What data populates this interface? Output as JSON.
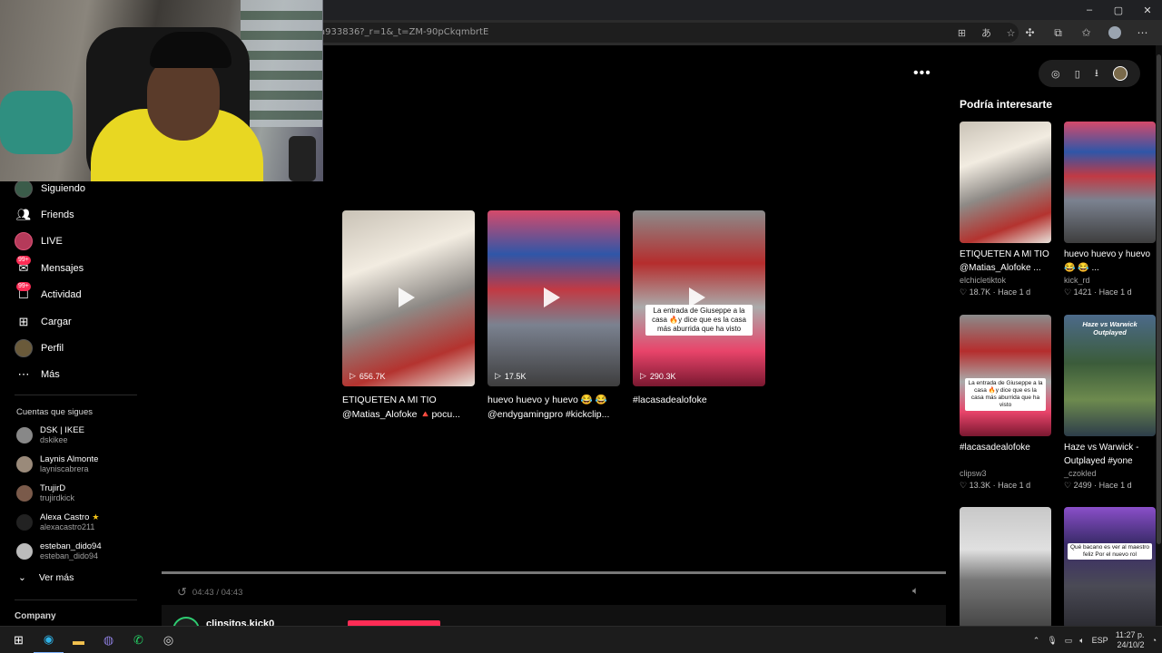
{
  "browser": {
    "url": "a933836?_r=1&_t=ZM-90pCkqmbrtE",
    "window_controls": [
      "–",
      "▢",
      "✕"
    ],
    "toolbar_icons": [
      "⊞",
      "あ",
      "☆",
      "⟳",
      "♡",
      "☆",
      "☺",
      "⋯"
    ],
    "extension_icons": [
      "◎",
      "▯",
      "⭳"
    ]
  },
  "sidebar": {
    "items": [
      {
        "label": "Siguiendo",
        "icon": "avatar-icon"
      },
      {
        "label": "Friends",
        "icon": "friends-icon"
      },
      {
        "label": "LIVE",
        "icon": "live-icon"
      },
      {
        "label": "Mensajes",
        "icon": "messages-icon",
        "badge": "99+"
      },
      {
        "label": "Actividad",
        "icon": "activity-icon",
        "badge": "99+"
      },
      {
        "label": "Cargar",
        "icon": "upload-icon"
      },
      {
        "label": "Perfil",
        "icon": "profile-icon"
      },
      {
        "label": "Más",
        "icon": "more-icon"
      }
    ],
    "following_title": "Cuentas que sigues",
    "accounts": [
      {
        "name": "DSK | IKEE",
        "user": "dskikee"
      },
      {
        "name": "Laynis Almonte",
        "user": "layniscabrera"
      },
      {
        "name": "TrujirD",
        "user": "trujirdkick"
      },
      {
        "name": "Alexa Castro",
        "user": "alexacastro211",
        "star": "★"
      },
      {
        "name": "esteban_dido94",
        "user": "esteban_dido94"
      }
    ],
    "see_more": "Ver más",
    "company": "Company"
  },
  "main": {
    "more_menu": "•••",
    "videos": [
      {
        "title": "ETIQUETEN A MI TIO @Matias_Alofoke 🔺pocu...",
        "views": "656.7K"
      },
      {
        "title": "huevo huevo y huevo 😂 😂 @endygamingpro #kickclip...",
        "views": "17.5K"
      },
      {
        "title": "#lacasadealofoke",
        "views": "290.3K",
        "caption": "La entrada de Giuseppe a la casa 🔥y dice que es la casa más aburrida que ha visto"
      }
    ],
    "progress": 1.0,
    "time": "04:43 / 04:43",
    "channel": "clipsitos.kick0"
  },
  "rail": {
    "title": "Podría interesarte",
    "items": [
      {
        "title": "ETIQUETEN A MI TIO @Matias_Alofoke ...",
        "user": "elchicletiktok",
        "likes": "18.7K",
        "age": "Hace 1 d"
      },
      {
        "title": "huevo huevo y huevo 😂 😂 ...",
        "user": "kick_rd",
        "likes": "1421",
        "age": "Hace 1 d"
      },
      {
        "title": "#lacasadealofoke",
        "user": "clipsw3",
        "likes": "13.3K",
        "age": "Hace 1 d",
        "caption": "La entrada de Giuseppe a la casa 🔥y dice que es la casa más aburrida que ha visto"
      },
      {
        "title": "Haze vs Warwick - Outplayed #yone",
        "user": "_czokled",
        "likes": "2499",
        "age": "Hace 1 d",
        "caption": "Haze vs Warwick Outplayed"
      },
      {
        "title": "",
        "user": "",
        "likes": "",
        "age": ""
      },
      {
        "title": "",
        "user": "",
        "likes": "",
        "age": "",
        "caption": "Qué bacano es ver al maestro feliz Por el nuevo rol"
      }
    ]
  },
  "taskbar": {
    "apps": [
      "⊞",
      "◉",
      "▬",
      "◍",
      "✆",
      "◎"
    ],
    "lang": "ESP",
    "time": "11:27 p.",
    "date": "24/10/2"
  }
}
